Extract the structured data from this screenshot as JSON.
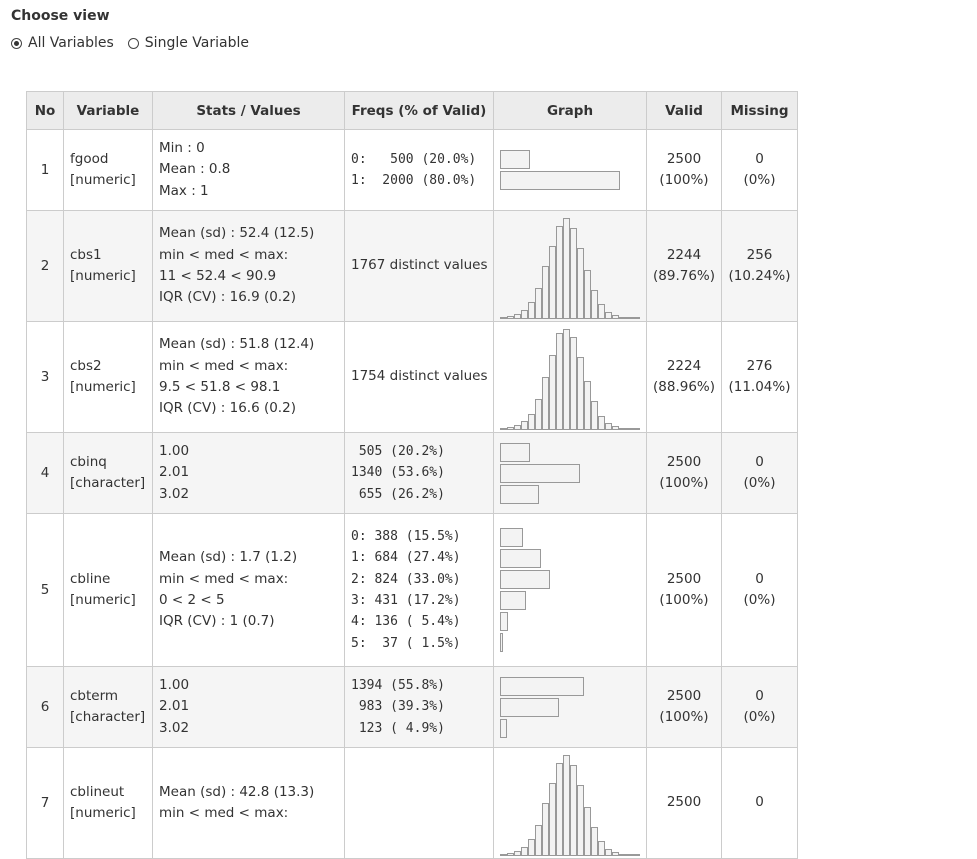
{
  "header": {
    "title": "Choose view"
  },
  "view_options": [
    {
      "label": "All Variables",
      "checked": true
    },
    {
      "label": "Single Variable",
      "checked": false
    }
  ],
  "table": {
    "columns": [
      "No",
      "Variable",
      "Stats / Values",
      "Freqs (% of Valid)",
      "Graph",
      "Valid",
      "Missing"
    ],
    "rows": [
      {
        "no": "1",
        "name": "fgood",
        "type": "[numeric]",
        "stats": [
          "Min : 0",
          "Mean : 0.8",
          "Max : 1"
        ],
        "freqs": [
          "0:   500 (20.0%)",
          "1:  2000 (80.0%)"
        ],
        "graph": {
          "kind": "bars",
          "values": [
            20.0,
            80.0
          ]
        },
        "valid_n": "2500",
        "valid_pct": "(100%)",
        "missing_n": "0",
        "missing_pct": "(0%)"
      },
      {
        "no": "2",
        "name": "cbs1",
        "type": "[numeric]",
        "stats": [
          "Mean (sd) : 52.4 (12.5)",
          "min < med < max:",
          "11 < 52.4 < 90.9",
          "IQR (CV) : 16.9 (0.2)"
        ],
        "freqs": [
          "1767 distinct values"
        ],
        "graph": {
          "kind": "hist",
          "values": [
            1,
            2,
            4,
            8,
            16,
            30,
            52,
            72,
            92,
            100,
            90,
            70,
            48,
            28,
            14,
            6,
            3,
            1,
            0,
            1
          ]
        },
        "valid_n": "2244",
        "valid_pct": "(89.76%)",
        "missing_n": "256",
        "missing_pct": "(10.24%)"
      },
      {
        "no": "3",
        "name": "cbs2",
        "type": "[numeric]",
        "stats": [
          "Mean (sd) : 51.8 (12.4)",
          "min < med < max:",
          "9.5 < 51.8 < 98.1",
          "IQR (CV) : 16.6 (0.2)"
        ],
        "freqs": [
          "1754 distinct values"
        ],
        "graph": {
          "kind": "hist",
          "values": [
            1,
            2,
            4,
            8,
            15,
            30,
            52,
            74,
            96,
            100,
            92,
            72,
            48,
            28,
            13,
            6,
            3,
            1,
            1,
            0
          ]
        },
        "valid_n": "2224",
        "valid_pct": "(88.96%)",
        "missing_n": "276",
        "missing_pct": "(11.04%)"
      },
      {
        "no": "4",
        "name": "cbinq",
        "type": "[character]",
        "stats": [
          "1.00",
          "2.01",
          "3.02"
        ],
        "freqs": [
          " 505 (20.2%)",
          "1340 (53.6%)",
          " 655 (26.2%)"
        ],
        "graph": {
          "kind": "bars",
          "values": [
            20.2,
            53.6,
            26.2
          ]
        },
        "valid_n": "2500",
        "valid_pct": "(100%)",
        "missing_n": "0",
        "missing_pct": "(0%)"
      },
      {
        "no": "5",
        "name": "cbline",
        "type": "[numeric]",
        "stats": [
          "Mean (sd) : 1.7 (1.2)",
          "min < med < max:",
          "0 < 2 < 5",
          "IQR (CV) : 1 (0.7)"
        ],
        "freqs": [
          "0: 388 (15.5%)",
          "1: 684 (27.4%)",
          "2: 824 (33.0%)",
          "3: 431 (17.2%)",
          "4: 136 ( 5.4%)",
          "5:  37 ( 1.5%)"
        ],
        "graph": {
          "kind": "bars",
          "values": [
            15.5,
            27.4,
            33.0,
            17.2,
            5.4,
            1.5
          ]
        },
        "valid_n": "2500",
        "valid_pct": "(100%)",
        "missing_n": "0",
        "missing_pct": "(0%)"
      },
      {
        "no": "6",
        "name": "cbterm",
        "type": "[character]",
        "stats": [
          "1.00",
          "2.01",
          "3.02"
        ],
        "freqs": [
          "1394 (55.8%)",
          " 983 (39.3%)",
          " 123 ( 4.9%)"
        ],
        "graph": {
          "kind": "bars",
          "values": [
            55.8,
            39.3,
            4.9
          ]
        },
        "valid_n": "2500",
        "valid_pct": "(100%)",
        "missing_n": "0",
        "missing_pct": "(0%)"
      },
      {
        "no": "7",
        "name": "cblineut",
        "type": "[numeric]",
        "stats": [
          "Mean (sd) : 42.8 (13.3)",
          "min < med < max:"
        ],
        "freqs": [],
        "graph": {
          "kind": "hist",
          "values": [
            1,
            2,
            4,
            8,
            16,
            30,
            52,
            72,
            92,
            100,
            90,
            70,
            48,
            28,
            14,
            6,
            3,
            1,
            0,
            1
          ]
        },
        "valid_n": "2500",
        "valid_pct": "",
        "missing_n": "0",
        "missing_pct": ""
      }
    ]
  }
}
